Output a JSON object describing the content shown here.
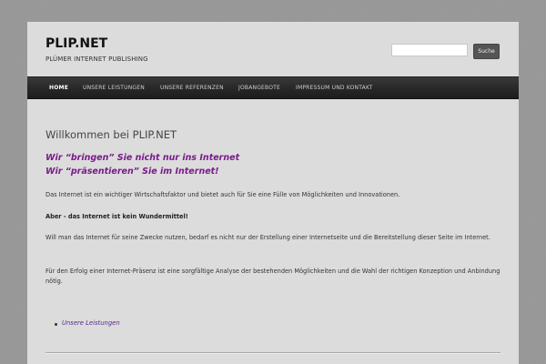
{
  "header": {
    "site_title": "PLIP.NET",
    "site_description": "PLÜMER INTERNET PUBLISHING",
    "search": {
      "value": "",
      "placeholder": "",
      "button_label": "Suche"
    }
  },
  "nav": {
    "items": [
      {
        "label": "HOME",
        "active": true
      },
      {
        "label": "UNSERE LEISTUNGEN",
        "active": false
      },
      {
        "label": "UNSERE REFERENZEN",
        "active": false
      },
      {
        "label": "JOBANGEBOTE",
        "active": false
      },
      {
        "label": "IMPRESSUM UND KONTAKT",
        "active": false
      }
    ]
  },
  "main": {
    "title": "Willkommen bei PLIP.NET",
    "slogan_1": "Wir “bringen” Sie nicht nur ins Internet",
    "slogan_2": "Wir “präsentieren” Sie im Internet!",
    "paragraph_1": "Das Internet ist ein wichtiger Wirtschaftsfaktor und bietet auch für Sie eine Fülle von Möglichkeiten und Innovationen.",
    "paragraph_2": "Aber - das Internet ist kein Wundermittel!",
    "paragraph_3": "Will man das Internet für seine Zwecke nutzen, bedarf es nicht nur der Erstellung einer Internetseite und die Bereitstellung dieser Seite im Internet.",
    "paragraph_4": "Für den Erfolg einer Internet-Präsenz ist eine sorgfältige Analyse der bestehenden Möglichkeiten und die Wahl der richtigen Konzeption und Anbindung nötig.",
    "links": [
      {
        "label": "Unsere Leistungen"
      }
    ]
  },
  "colors": {
    "slogan": "#7a1a8a",
    "link": "#5a2a8a",
    "nav_bg": "#2a2a2a",
    "page_bg": "#dcdcdc",
    "body_bg": "#979797"
  }
}
